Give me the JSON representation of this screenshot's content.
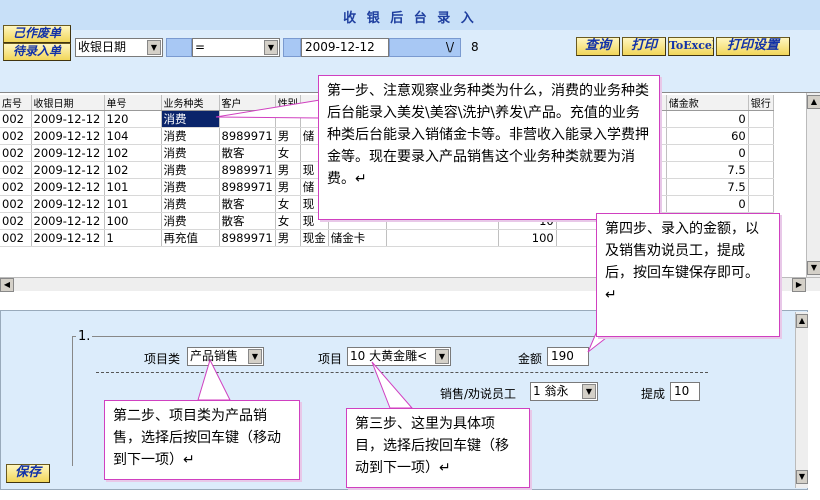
{
  "window": {
    "title": "收 银 后 台 录 入"
  },
  "toolbar": {
    "void_label": "己作废单",
    "pending_label": "待录入单",
    "filter_field": "收银日期",
    "filter_op": "=",
    "filter_value": "2009-12-12",
    "filter_extra": "\\/",
    "record_count": "8",
    "query_label": "查询",
    "print_label": "打印",
    "excel_label": "ToExcel",
    "print_setup_label": "打印设置"
  },
  "grid": {
    "columns": [
      "店号",
      "收银日期",
      "单号",
      "业务种类",
      "客户",
      "性别",
      "储金款",
      "银行"
    ],
    "rows": [
      {
        "store": "002",
        "date": "2009-12-12",
        "no": "120",
        "type": "消费",
        "customer": "",
        "gender": "",
        "deposit": "0"
      },
      {
        "store": "002",
        "date": "2009-12-12",
        "no": "104",
        "type": "消费",
        "customer": "8989971",
        "gender": "男",
        "deposit": "60"
      },
      {
        "store": "002",
        "date": "2009-12-12",
        "no": "102",
        "type": "消费",
        "customer": "散客",
        "gender": "女",
        "deposit": "0"
      },
      {
        "store": "002",
        "date": "2009-12-12",
        "no": "102",
        "type": "消费",
        "customer": "8989971",
        "gender": "男",
        "deposit": "7.5"
      },
      {
        "store": "002",
        "date": "2009-12-12",
        "no": "101",
        "type": "消费",
        "customer": "8989971",
        "gender": "男",
        "deposit": "7.5"
      },
      {
        "store": "002",
        "date": "2009-12-12",
        "no": "101",
        "type": "消费",
        "customer": "散客",
        "gender": "女",
        "deposit": "0"
      },
      {
        "store": "002",
        "date": "2009-12-12",
        "no": "100",
        "type": "消费",
        "customer": "散客",
        "gender": "女",
        "pay": "现",
        "amount": "10"
      },
      {
        "store": "002",
        "date": "2009-12-12",
        "no": "1",
        "type": "再充值",
        "customer": "8989971",
        "gender": "男",
        "pay": "现金",
        "card": "储金卡",
        "amount": "100"
      }
    ],
    "row_partials": [
      "",
      "储",
      "",
      "现",
      "储",
      "现",
      "",
      ""
    ]
  },
  "detail": {
    "group_no": "1.",
    "item_type_label": "项目类",
    "item_type_value": "产品销售",
    "item_label": "项目",
    "item_value": "10  大黄金雕<",
    "amount_label": "金额",
    "amount_value": "190",
    "staff_label": "销售/劝说员工",
    "staff_value": "1   翁永",
    "commission_label": "提成",
    "commission_value": "10",
    "save_label": "保存"
  },
  "callouts": {
    "step1": "第一步、注意观察业务种类为什么，消费的业务种类后台能录入美发\\美容\\洗护\\养发\\产品。充值的业务种类后台能录入销储金卡等。非营收入能录入学费押金等。现在要录入产品销售这个业务种类就要为消费。↵",
    "step2": "第二步、项目类为产品销售，选择后按回车键（移动到下一项）↵",
    "step3": "第三步、这里为具体项目，选择后按回车键（移动到下一项）↵",
    "step4": "第四步、录入的金额，以及销售劝说员工，提成后，按回车键保存即可。 ↵"
  }
}
